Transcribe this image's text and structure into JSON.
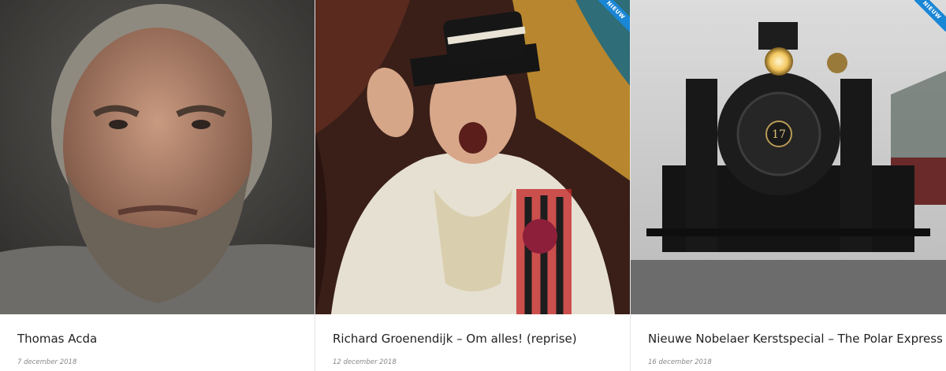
{
  "badge_label": "NIEUW",
  "accent_color": "#1a86d6",
  "cards": [
    {
      "title": "Thomas Acda",
      "date": "7 december 2018",
      "image": "portrait-bearded-man"
    },
    {
      "title": "Richard Groenendijk – Om alles! (reprise)",
      "date": "12 december 2018",
      "image": "performer-in-costume"
    },
    {
      "title": "Nieuwe Nobelaer Kerstspecial – The Polar Express",
      "date": "16 december 2018",
      "image": "steam-locomotive-snow"
    }
  ]
}
